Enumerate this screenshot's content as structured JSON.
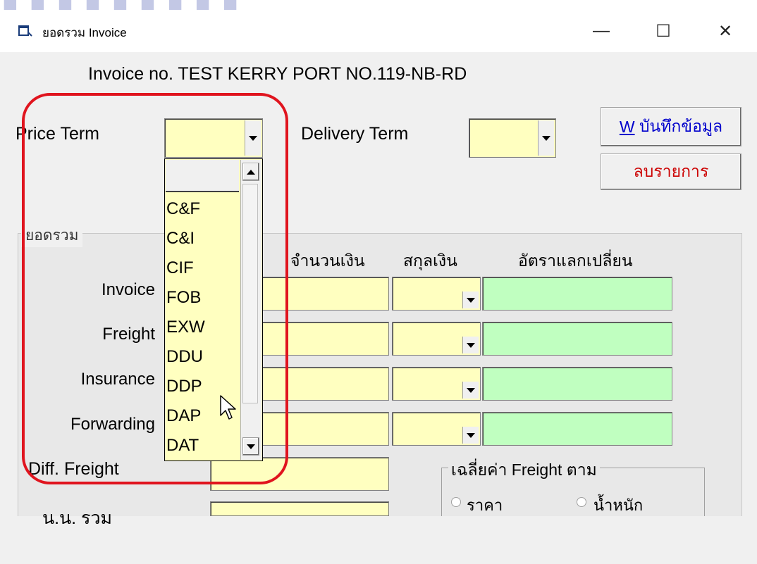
{
  "window": {
    "title": "ยอดรวม Invoice",
    "minimize_glyph": "—",
    "maximize_glyph": "☐",
    "close_glyph": "✕"
  },
  "invoice_title": "Invoice no. TEST KERRY PORT NO.119-NB-RD",
  "price_term": {
    "label": "Price Term",
    "value": ""
  },
  "delivery_term": {
    "label": "Delivery Term",
    "value": ""
  },
  "buttons": {
    "save_accel": "W",
    "save_label": " บันทึกข้อมูล",
    "delete_label": "ลบรายการ"
  },
  "dropdown": {
    "options": [
      "",
      "C&F",
      "C&I",
      "CIF",
      "FOB",
      "EXW",
      "DDU",
      "DDP",
      "DAP",
      "DAT"
    ]
  },
  "totals": {
    "legend": "ยอดรวม",
    "headers": {
      "amount": "จำนวนเงิน",
      "currency": "สกุลเงิน",
      "exchange": "อัตราแลกเปลี่ยน"
    },
    "rows": [
      {
        "label": "Invoice"
      },
      {
        "label": "Freight"
      },
      {
        "label": "Insurance"
      },
      {
        "label": "Forwarding"
      }
    ],
    "diff_freight_label": "Diff. Freight",
    "last_label": "น.น. รวม"
  },
  "freight_average": {
    "legend": "เฉลี่ยค่า Freight ตาม",
    "options": [
      "ราคา",
      "น้ำหนัก"
    ]
  },
  "colors": {
    "field_yellow": "#ffffc0",
    "field_green": "#c0ffc0",
    "highlight_red": "#e0141e",
    "link_blue": "#0000cc",
    "delete_red": "#cc0000"
  }
}
